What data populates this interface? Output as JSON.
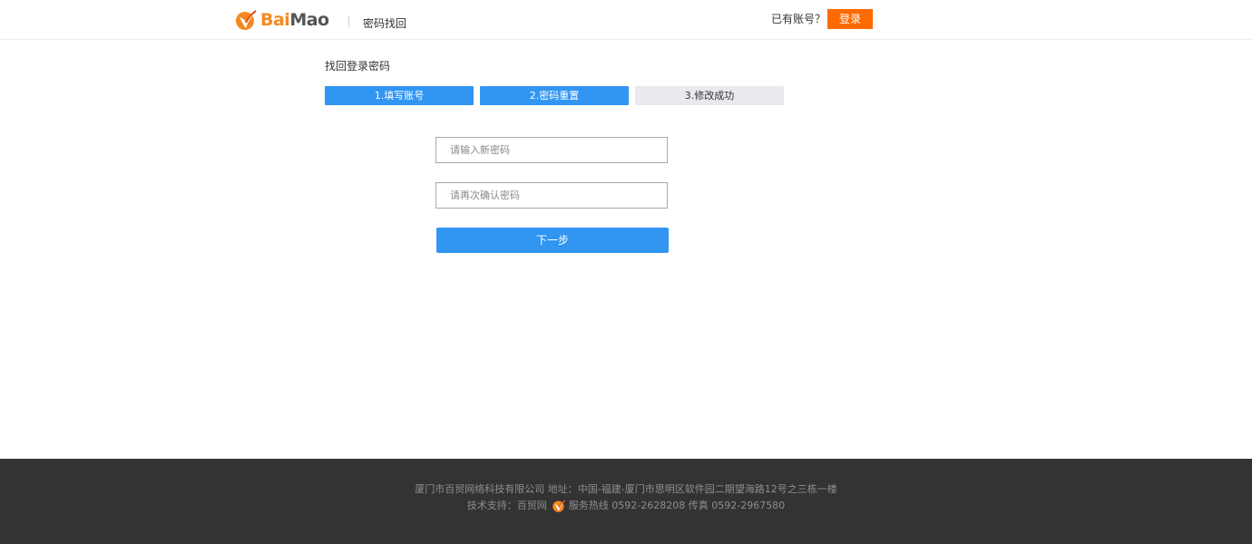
{
  "header": {
    "logo": {
      "part1": "Bai",
      "part2": "Mao"
    },
    "page_name": "密码找回",
    "have_account": "已有账号？",
    "login_label": "登录"
  },
  "main": {
    "title": "找回登录密码",
    "steps": [
      {
        "label": "1.填写账号",
        "active": true
      },
      {
        "label": "2.密码重置",
        "active": true
      },
      {
        "label": "3.修改成功",
        "active": false
      }
    ],
    "new_password": {
      "value": "",
      "placeholder": "请输入新密码"
    },
    "confirm_password": {
      "value": "",
      "placeholder": "请再次确认密码"
    },
    "next_label": "下一步"
  },
  "footer": {
    "line1": "厦门市百贸网络科技有限公司 地址：中国-福建-厦门市思明区软件园二期望海路12号之三栋一楼",
    "line2_left": "技术支持：百贸网",
    "line2_right": "服务热线 0592-2628208 传真 0592-2967580"
  },
  "colors": {
    "brand_orange": "#ff6a00",
    "logo_orange": "#f5891f",
    "primary_blue": "#3195f2",
    "step_inactive": "#e9e9ee",
    "footer_bg": "#333333"
  }
}
